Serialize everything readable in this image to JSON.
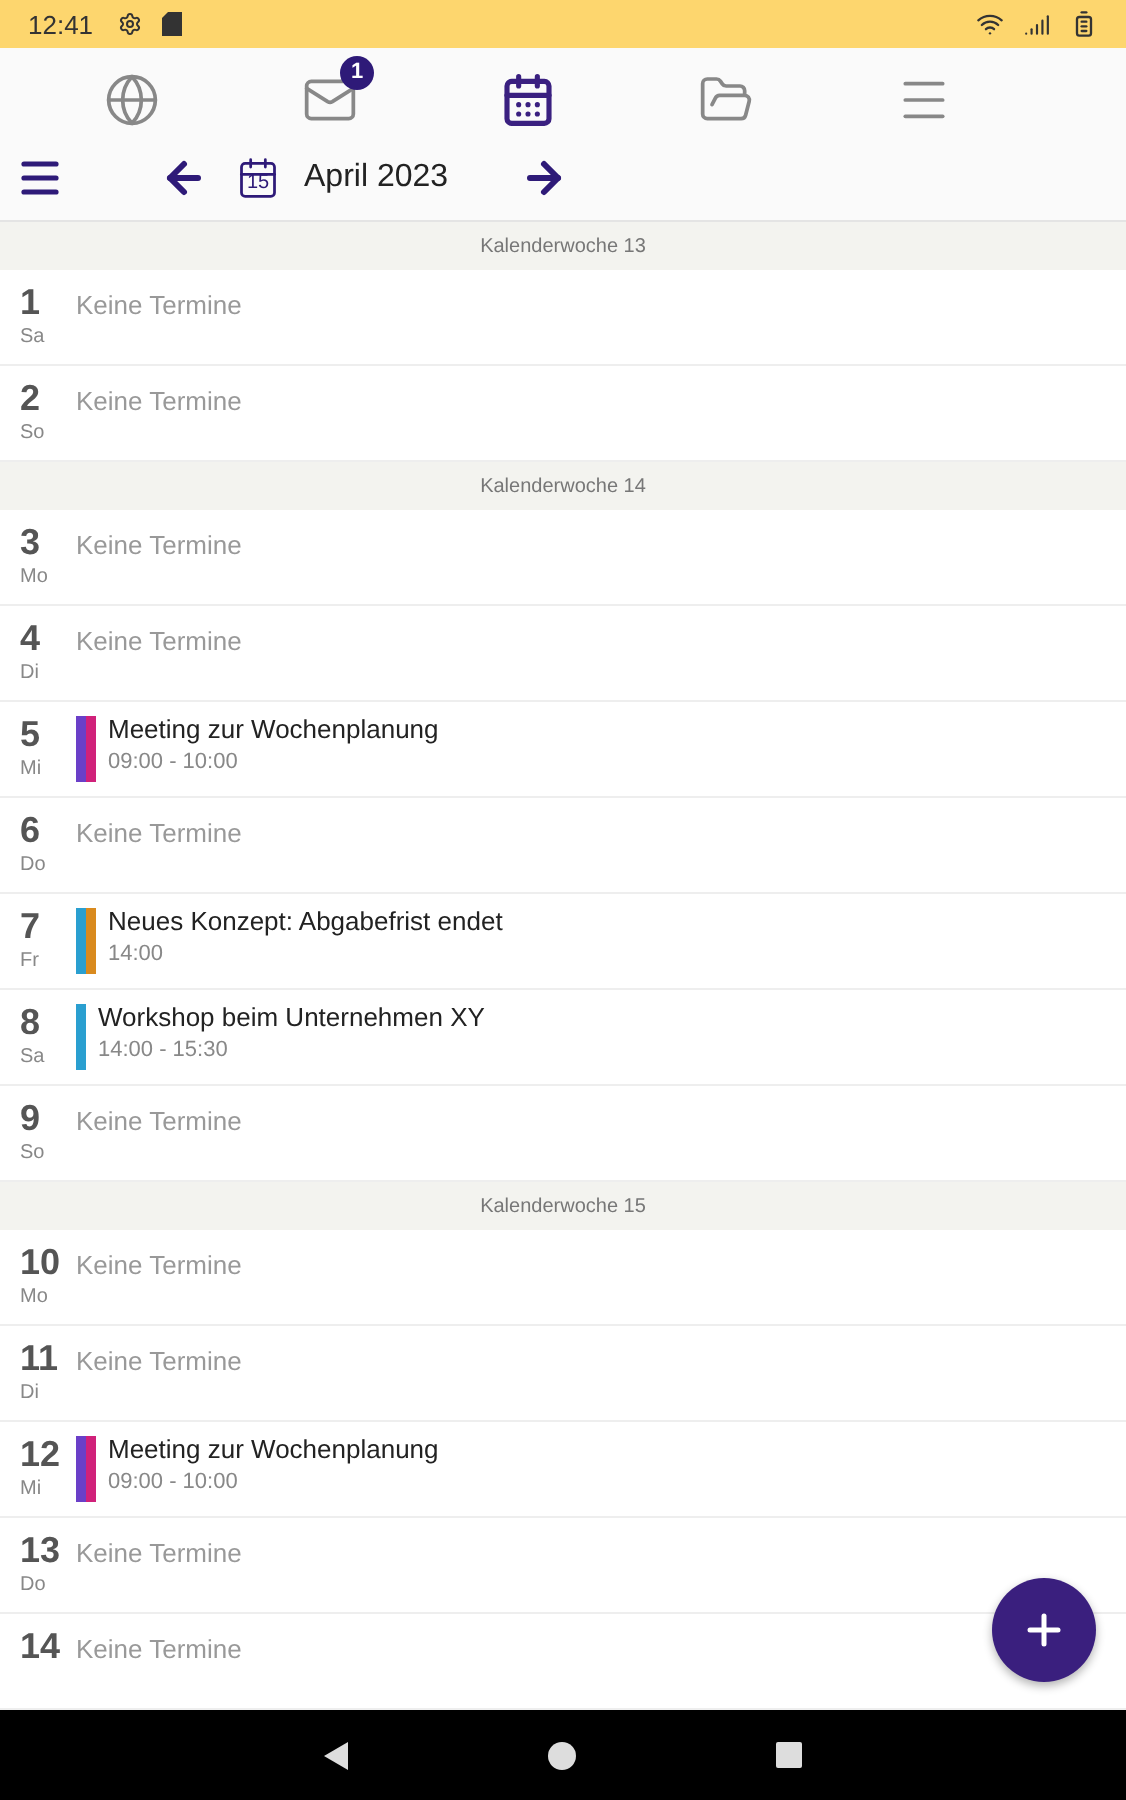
{
  "status_bar": {
    "time": "12:41"
  },
  "top_nav": [
    {
      "kind": "globe",
      "selected": false
    },
    {
      "kind": "mail",
      "selected": false,
      "badge": "1"
    },
    {
      "kind": "calendar",
      "selected": true
    },
    {
      "kind": "folder",
      "selected": false
    },
    {
      "kind": "menu",
      "selected": false
    }
  ],
  "toolbar": {
    "today_icon_day": "15",
    "month": "April 2023"
  },
  "agenda": [
    {
      "kind": "week",
      "label": "Kalenderwoche 13"
    },
    {
      "kind": "day",
      "day": "1",
      "weekday": "Sa",
      "empty": "Keine Termine"
    },
    {
      "kind": "day",
      "day": "2",
      "weekday": "So",
      "empty": "Keine Termine"
    },
    {
      "kind": "week",
      "label": "Kalenderwoche 14"
    },
    {
      "kind": "day",
      "day": "3",
      "weekday": "Mo",
      "empty": "Keine Termine"
    },
    {
      "kind": "day",
      "day": "4",
      "weekday": "Di",
      "empty": "Keine Termine"
    },
    {
      "kind": "day",
      "day": "5",
      "weekday": "Mi",
      "events": [
        {
          "title": "Meeting zur Wochenplanung",
          "time": "09:00 - 10:00",
          "stripes": [
            {
              "color": "#6a3fc8"
            },
            {
              "color": "#d0217a"
            }
          ]
        }
      ]
    },
    {
      "kind": "day",
      "day": "6",
      "weekday": "Do",
      "empty": "Keine Termine"
    },
    {
      "kind": "day",
      "day": "7",
      "weekday": "Fr",
      "events": [
        {
          "title": "Neues Konzept: Abgabefrist endet",
          "time": "14:00",
          "stripes": [
            {
              "color": "#2a9fd0"
            },
            {
              "color": "#d98a1e"
            }
          ]
        }
      ]
    },
    {
      "kind": "day",
      "day": "8",
      "weekday": "Sa",
      "events": [
        {
          "title": "Workshop beim Unternehmen XY",
          "time": "14:00 - 15:30",
          "stripes": [
            {
              "color": "#2a9fd0"
            }
          ]
        }
      ]
    },
    {
      "kind": "day",
      "day": "9",
      "weekday": "So",
      "empty": "Keine Termine"
    },
    {
      "kind": "week",
      "label": "Kalenderwoche 15"
    },
    {
      "kind": "day",
      "day": "10",
      "weekday": "Mo",
      "empty": "Keine Termine"
    },
    {
      "kind": "day",
      "day": "11",
      "weekday": "Di",
      "empty": "Keine Termine"
    },
    {
      "kind": "day",
      "day": "12",
      "weekday": "Mi",
      "events": [
        {
          "title": "Meeting zur Wochenplanung",
          "time": "09:00 - 10:00",
          "stripes": [
            {
              "color": "#6a3fc8"
            },
            {
              "color": "#d0217a"
            }
          ]
        }
      ]
    },
    {
      "kind": "day",
      "day": "13",
      "weekday": "Do",
      "empty": "Keine Termine"
    },
    {
      "kind": "day",
      "day": "14",
      "empty": "Keine Termine"
    }
  ]
}
